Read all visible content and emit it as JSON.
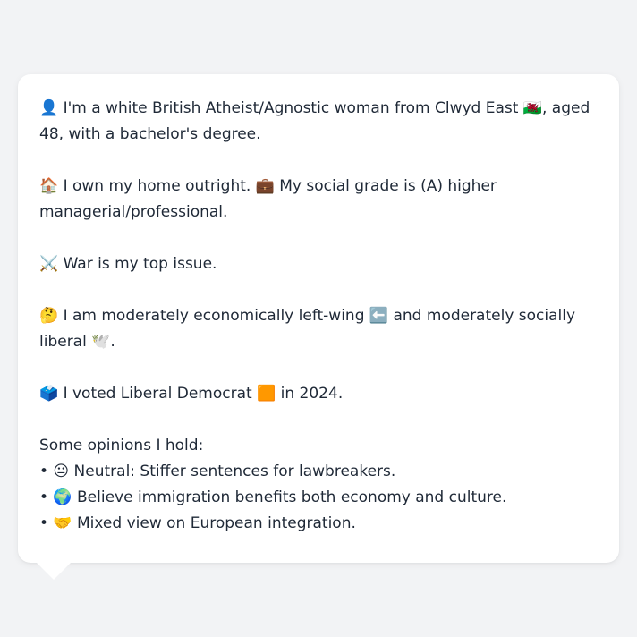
{
  "profile": {
    "identity": "👤 I'm a white British Atheist/Agnostic woman from Clwyd East 🏴󠁧󠁢󠁷󠁬󠁳󠁿, aged 48, with a bachelor's degree.",
    "housing": "🏠 I own my home outright. 💼 My social grade is (A) higher managerial/professional.",
    "top_issue": "⚔️ War is my top issue.",
    "ideology": "🤔 I am moderately economically left-wing ⬅️ and moderately socially liberal 🕊️.",
    "vote": "🗳️ I voted Liberal Democrat 🟧 in 2024.",
    "opinions_heading": "Some opinions I hold:",
    "opinions": [
      "• 😐 Neutral: Stiffer sentences for lawbreakers.",
      "• 🌍 Believe immigration benefits both economy and culture.",
      "• 🤝 Mixed view on European integration."
    ]
  }
}
